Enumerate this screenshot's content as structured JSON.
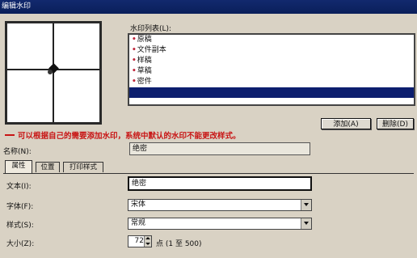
{
  "window": {
    "title": "编辑水印"
  },
  "watermark_list": {
    "label": "水印列表(L):",
    "items": [
      {
        "label": "原稿",
        "selected": false
      },
      {
        "label": "文件副本",
        "selected": false
      },
      {
        "label": "样稿",
        "selected": false
      },
      {
        "label": "草稿",
        "selected": false
      },
      {
        "label": "密件",
        "selected": false
      },
      {
        "label": "",
        "selected": true
      }
    ]
  },
  "buttons": {
    "add": "添加(A)",
    "delete": "删除(D)"
  },
  "annotation": "可以根据自己的需要添加水印，系统中默认的水印不能更改样式。",
  "name": {
    "label": "名称(N):",
    "value": "绝密"
  },
  "tabs": [
    {
      "label": "属性",
      "active": true
    },
    {
      "label": "位置",
      "active": false
    },
    {
      "label": "打印样式",
      "active": false
    }
  ],
  "properties": {
    "text_label": "文本(I):",
    "text_value": "绝密",
    "font_label": "字体(F):",
    "font_value": "宋体",
    "style_label": "样式(S):",
    "style_value": "常规",
    "size_label": "大小(Z):",
    "size_value": "72",
    "size_unit": "点 (1 至 500)"
  },
  "colors": {
    "title_bar": "#0a1f5a",
    "selection": "#0c1e6e",
    "annotation": "#c81414",
    "bullet": "#c0283c"
  }
}
